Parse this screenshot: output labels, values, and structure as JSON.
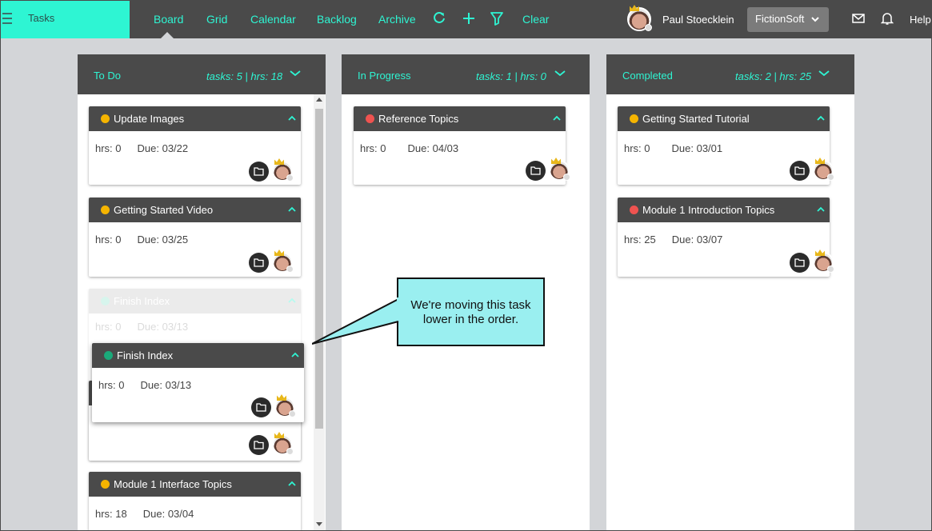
{
  "app": {
    "title": "Tasks"
  },
  "nav": [
    {
      "label": "Board"
    },
    {
      "label": "Grid"
    },
    {
      "label": "Calendar"
    },
    {
      "label": "Backlog"
    },
    {
      "label": "Archive"
    }
  ],
  "toolbar": {
    "clear_label": "Clear",
    "icons": [
      "refresh-icon",
      "add-icon",
      "filter-icon"
    ]
  },
  "user": {
    "name": "Paul Stoecklein"
  },
  "org": {
    "selected": "FictionSoft"
  },
  "help_label": "Help",
  "colors": {
    "accent": "#2ef5d3",
    "header": "#4a4a4a",
    "yellow": "#f5b400",
    "red": "#ef5350",
    "green": "#1aaa7a",
    "callout": "#9aeff0"
  },
  "columns": [
    {
      "title": "To Do",
      "stats": "tasks: 5 | hrs: 18",
      "cards": [
        {
          "title": "Update Images",
          "hrs": "hrs: 0",
          "due": "Due: 03/22",
          "status": "yellow"
        },
        {
          "title": "Getting Started Video",
          "hrs": "hrs: 0",
          "due": "Due: 03/25",
          "status": "yellow"
        },
        {
          "title": "Finish Index",
          "hrs": "hrs: 0",
          "due": "Due: 03/13",
          "status": "green"
        },
        {
          "title": "Module 1 Interface Topics",
          "hrs": "hrs: 18",
          "due": "Due: 03/04",
          "status": "yellow"
        }
      ]
    },
    {
      "title": "In Progress",
      "stats": "tasks: 1 | hrs: 0",
      "cards": [
        {
          "title": "Reference Topics",
          "hrs": "hrs: 0",
          "due": "Due: 04/03",
          "status": "red"
        }
      ]
    },
    {
      "title": "Completed",
      "stats": "tasks: 2 | hrs: 25",
      "cards": [
        {
          "title": "Getting Started Tutorial",
          "hrs": "hrs: 0",
          "due": "Due: 03/01",
          "status": "yellow"
        },
        {
          "title": "Module 1 Introduction Topics",
          "hrs": "hrs: 25",
          "due": "Due: 03/07",
          "status": "red"
        }
      ]
    }
  ],
  "dragging": {
    "title": "Finish Index",
    "hrs": "hrs: 0",
    "due": "Due: 03/13"
  },
  "callout": {
    "text": "We're moving this task lower in the order."
  }
}
